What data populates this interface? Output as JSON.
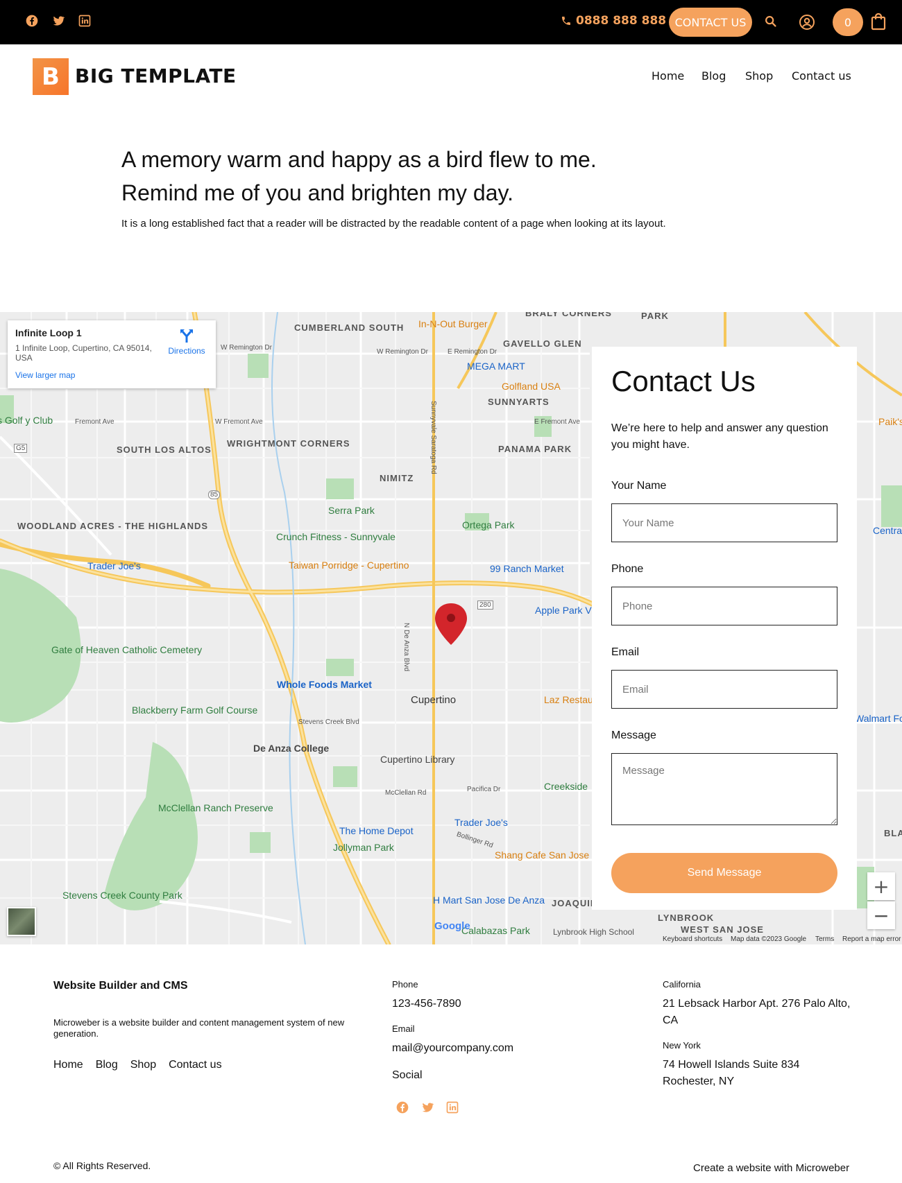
{
  "topbar": {
    "social": [
      "facebook-icon",
      "twitter-icon",
      "linkedin-icon"
    ],
    "phone": "0888 888 888",
    "contact_button": "CONTACT US",
    "cart_count": "0"
  },
  "header": {
    "logo_letter": "B",
    "logo_text": "BIG TEMPLATE",
    "nav": [
      "Home",
      "Blog",
      "Shop",
      "Contact us"
    ]
  },
  "hero": {
    "line1": "A memory warm and happy as a bird flew to me.",
    "line2": "Remind me of you and brighten my day.",
    "paragraph": "It is a long established fact that a reader will be distracted by the readable content of a page when looking at its layout."
  },
  "map": {
    "card_title": "Infinite Loop 1",
    "card_address": "1 Infinite Loop, Cupertino, CA 95014, USA",
    "card_directions": "Directions",
    "card_larger_map": "View larger map",
    "labels": {
      "cumberland": "CUMBERLAND SOUTH",
      "inout": "In-N-Out Burger",
      "braly": "BRALY CORNERS",
      "park": "PARK",
      "gavello": "GAVELLO GLEN",
      "megamart": "MEGA MART",
      "golfland": "Golfland USA",
      "sunnyarts": "SUNNYARTS",
      "remington1": "W Remington Dr",
      "remington2": "W Remington Dr",
      "remington3": "E Remington Dr",
      "fremont1": "Fremont Ave",
      "fremont2": "W Fremont Ave",
      "fremont3": "E Fremont Ave",
      "golfclub": "s Golf y Club",
      "southlosaltos": "SOUTH LOS ALTOS",
      "wrightmont": "WRIGHTMONT CORNERS",
      "nimitz": "NIMITZ",
      "panama": "PANAMA PARK",
      "woodland": "WOODLAND ACRES - THE HIGHLANDS",
      "serra": "Serra Park",
      "crunch": "Crunch Fitness - Sunnyvale",
      "ortega": "Ortega Park",
      "traderjoes1": "Trader Joe's",
      "taiwan": "Taiwan Porridge - Cupertino",
      "ranch99": "99 Ranch Market",
      "applepark": "Apple Park Vi",
      "gateofheaven": "Gate of Heaven Catholic Cemetery",
      "wholefoods": "Whole Foods Market",
      "cupertino": "Cupertino",
      "blackberry": "Blackberry Farm Golf Course",
      "deanza": "De Anza College",
      "library": "Cupertino Library",
      "creekside": "Creekside",
      "mcclellan": "McClellan Ranch Preserve",
      "homedepot": "The Home Depot",
      "traderjoes2": "Trader Joe's",
      "jollyman": "Jollyman Park",
      "shangcafe": "Shang Cafe San Jose",
      "stevenscreek": "Stevens Creek County Park",
      "hmart": "H Mart San Jose De Anza",
      "joaquin": "JOAQUIN",
      "lynbrook": "LYNBROOK",
      "westsanjose": "WEST SAN JOSE",
      "calabazas": "Calabazas Park",
      "lynbrookhs": "Lynbrook High School",
      "stevenscreekblvd": "Stevens Creek Blvd",
      "mcclellanrd": "McClellan Rd",
      "pacifica": "Pacifica Dr",
      "bollinger": "Bollinger Rd",
      "ndeanza": "N De Anza Blvd",
      "sunnyvalesaratoga": "Sunnyvale Saratoga Rd",
      "walmart": "Walmart Food Market",
      "lazy": "Laz Restaurant",
      "paiks": "Paik's",
      "centra": "Centra",
      "bla": "BLA",
      "gw280": "280",
      "gw85": "85",
      "g5": "G5"
    },
    "footer": {
      "shortcuts": "Keyboard shortcuts",
      "mapdata": "Map data ©2023 Google",
      "terms": "Terms",
      "report": "Report a map error",
      "google": "Google"
    }
  },
  "contact_form": {
    "title": "Contact Us",
    "subtitle": "We’re here to help and answer any question you might have.",
    "name_label": "Your Name",
    "name_placeholder": "Your Name",
    "phone_label": "Phone",
    "phone_placeholder": "Phone",
    "email_label": "Email",
    "email_placeholder": "Email",
    "message_label": "Message",
    "message_placeholder": "Message",
    "send": "Send Message"
  },
  "footer": {
    "title": "Website Builder and CMS",
    "description": "Microweber is a website builder and content management system of new generation.",
    "links": [
      "Home",
      "Blog",
      "Shop",
      "Contact us"
    ],
    "phone_label": "Phone",
    "phone": "123-456-7890",
    "email_label": "Email",
    "email": "mail@yourcompany.com",
    "social_label": "Social",
    "california_label": "California",
    "california_address": "21 Lebsack Harbor Apt. 276 Palo Alto, CA",
    "newyork_label": "New York",
    "newyork_address": "74 Howell Islands Suite 834 Rochester, NY",
    "copyright": "© All Rights Reserved.",
    "credit": "Create a website with Microweber"
  },
  "colors": {
    "accent": "#f5a25d",
    "logo": "#f7752a",
    "topbar": "#000000"
  }
}
